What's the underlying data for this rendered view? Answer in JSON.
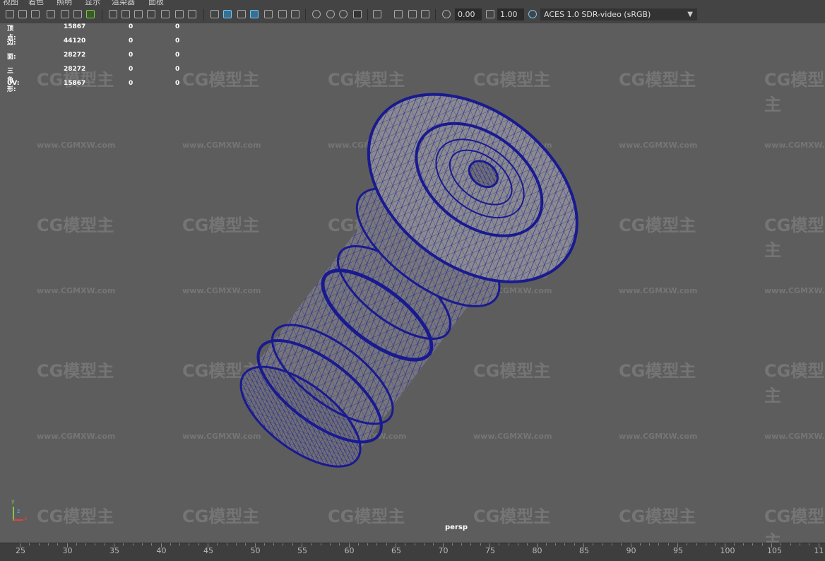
{
  "menu": [
    "视图",
    "着色",
    "照明",
    "显示",
    "渲染器",
    "面板"
  ],
  "toolbar": {
    "exposure_value": "0.00",
    "gamma_value": "1.00",
    "color_space": "ACES 1.0 SDR-video (sRGB)"
  },
  "hud": {
    "rows": [
      {
        "label": "顶点:",
        "total": "15867",
        "sel1": "0",
        "sel2": "0"
      },
      {
        "label": "边:",
        "total": "44120",
        "sel1": "0",
        "sel2": "0"
      },
      {
        "label": "面:",
        "total": "28272",
        "sel1": "0",
        "sel2": "0"
      },
      {
        "label": "三角形:",
        "total": "28272",
        "sel1": "0",
        "sel2": "0"
      },
      {
        "label": "UV:",
        "total": "15867",
        "sel1": "0",
        "sel2": "0"
      }
    ]
  },
  "camera_label": "persp",
  "axis": {
    "x": "x",
    "y": "y",
    "z": "z"
  },
  "watermark": {
    "logo": "CG模型主",
    "url": "www.CGMXW.com"
  },
  "timeline_ticks": [
    "25",
    "30",
    "35",
    "40",
    "45",
    "50",
    "55",
    "60",
    "65",
    "70",
    "75",
    "80",
    "85",
    "90",
    "95",
    "100",
    "105",
    "11"
  ],
  "colors": {
    "wire": "#1a1a90",
    "shade": "#7c7c80",
    "viewport_bg": "#5d5d5d"
  }
}
